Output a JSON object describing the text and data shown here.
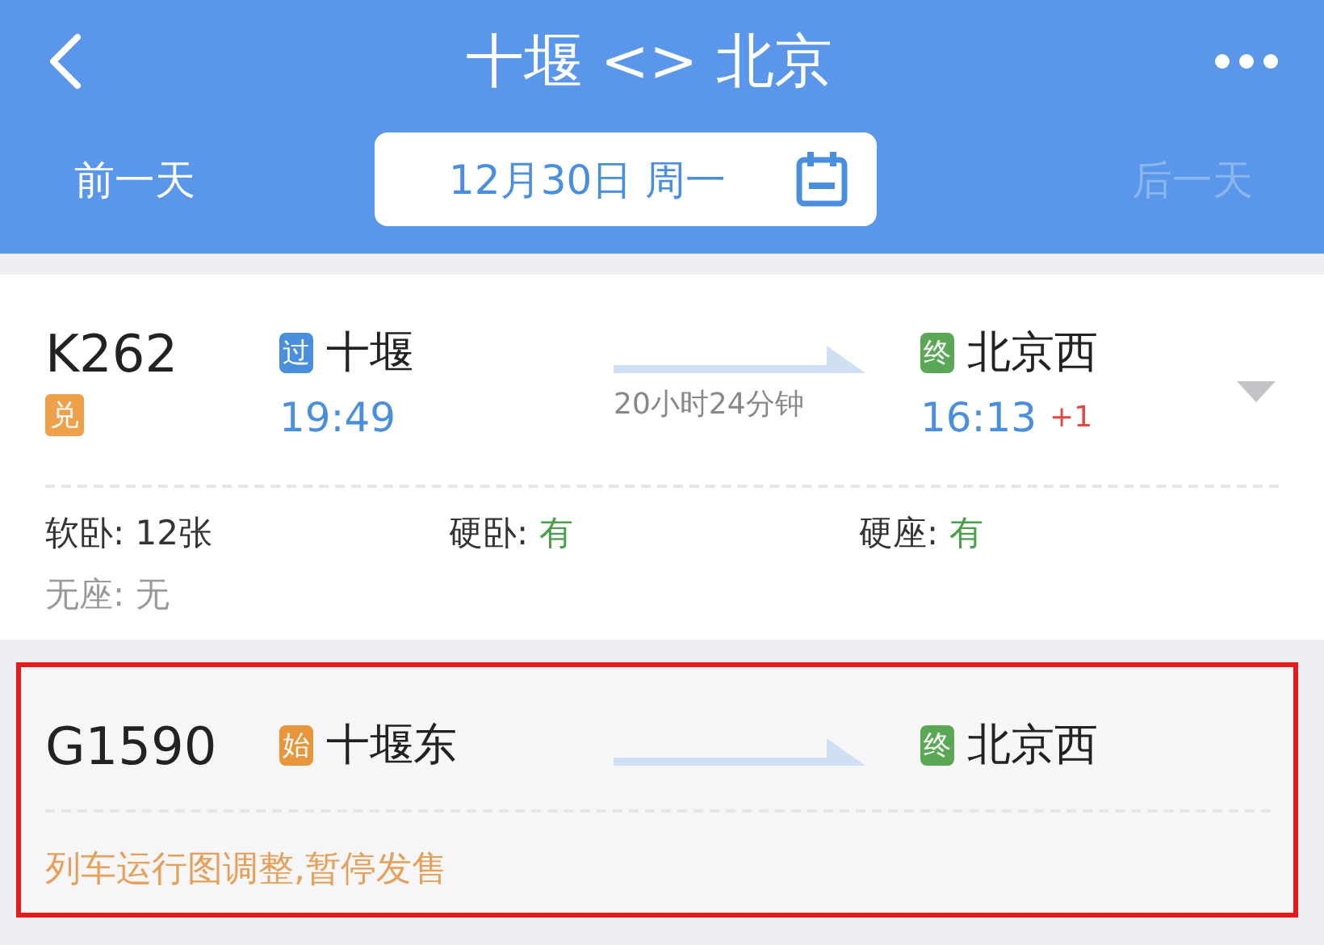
{
  "header": {
    "title": "十堰 <> 北京",
    "prev_day": {
      "label": "前一天",
      "disabled": false
    },
    "date": "12月30日 周一",
    "next_day": {
      "label": "后一天",
      "disabled": true
    }
  },
  "trains": [
    {
      "number": "K262",
      "tag": "兑",
      "expandable": true,
      "highlighted": false,
      "from": {
        "badge": "过",
        "kind": "pass",
        "name": "十堰",
        "time": "19:49"
      },
      "duration": "20小时24分钟",
      "to": {
        "badge": "终",
        "kind": "end",
        "name": "北京西",
        "time": "16:13",
        "day_offset": "+1"
      },
      "seats": [
        {
          "label": "软卧:",
          "value": "12张",
          "kind": "count"
        },
        {
          "label": "硬卧:",
          "value": "有",
          "kind": "plenty"
        },
        {
          "label": "硬座:",
          "value": "有",
          "kind": "plenty"
        },
        {
          "label": "无座:",
          "value": "无",
          "kind": "none"
        }
      ]
    },
    {
      "number": "G1590",
      "expandable": false,
      "highlighted": true,
      "from": {
        "badge": "始",
        "kind": "start",
        "name": "十堰东"
      },
      "to": {
        "badge": "终",
        "kind": "end",
        "name": "北京西"
      },
      "notice": "列车运行图调整,暂停发售"
    }
  ]
}
